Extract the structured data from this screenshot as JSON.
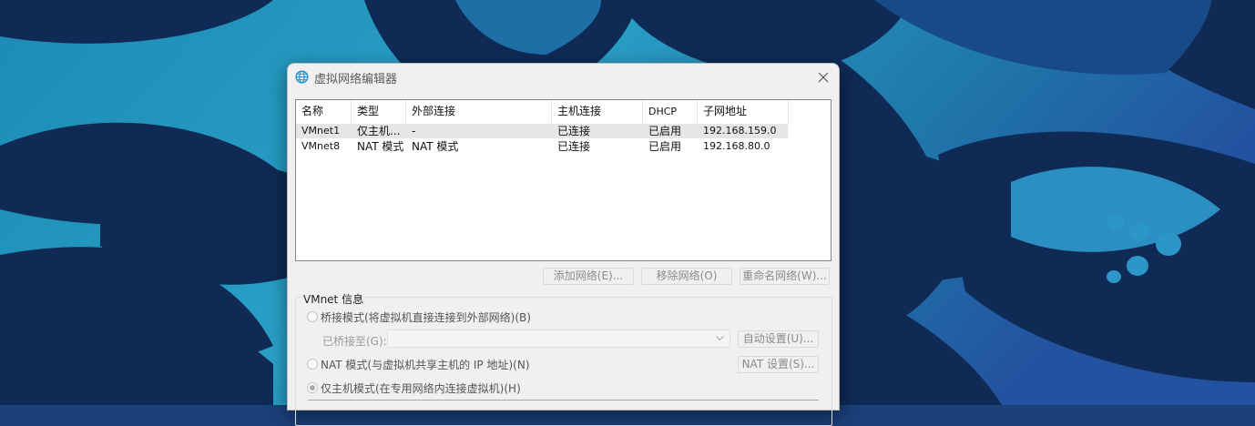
{
  "dialog": {
    "title": "虚拟网络编辑器",
    "icon": "network-globe-icon"
  },
  "table": {
    "columns": [
      "名称",
      "类型",
      "外部连接",
      "主机连接",
      "DHCP",
      "子网地址"
    ],
    "rows": [
      [
        "VMnet1",
        "仅主机...",
        "-",
        "已连接",
        "已启用",
        "192.168.159.0"
      ],
      [
        "VMnet8",
        "NAT 模式",
        "NAT 模式",
        "已连接",
        "已启用",
        "192.168.80.0"
      ]
    ]
  },
  "buttons": {
    "add": "添加网络(E)...",
    "remove": "移除网络(O)",
    "rename": "重命名网络(W)..."
  },
  "vmnet_info": {
    "title": "VMnet 信息",
    "bridged_label": "桥接模式(将虚拟机直接连接到外部网络)(B)",
    "bridged_to_label": "已桥接至(G):",
    "bridged_to_value": "",
    "auto_settings": "自动设置(U)...",
    "nat_label": "NAT 模式(与虚拟机共享主机的 IP 地址)(N)",
    "nat_settings": "NAT 设置(S)...",
    "hostonly_label": "仅主机模式(在专用网络内连接虚拟机)(H)",
    "selected_mode": "host-only"
  },
  "colors": {
    "wallpaper_dark": "#0f2a55",
    "wallpaper_teal": "#2a97c0",
    "dialog_bg": "#f0f0f0"
  }
}
